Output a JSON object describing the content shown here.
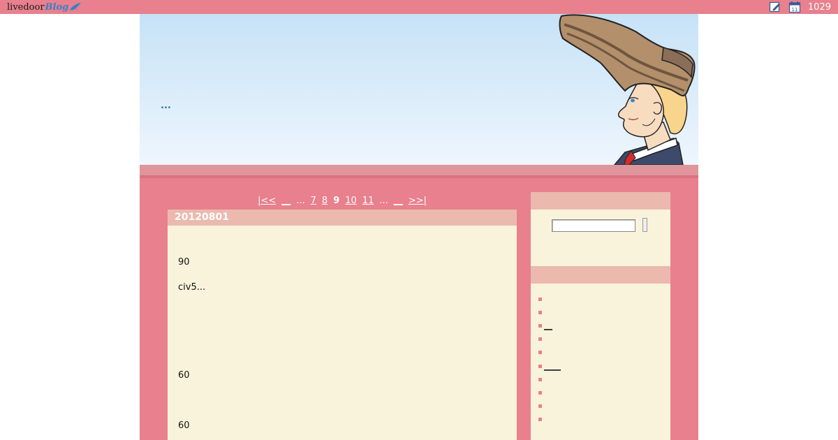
{
  "topbar": {
    "logo_main": "livedoor",
    "logo_blog": "Blog",
    "count": "1029",
    "icons": [
      "edit-icon",
      "calendar-icon"
    ],
    "calendar_day": "11"
  },
  "header": {
    "link_text": "..."
  },
  "pager": {
    "first": "|<<",
    "prev": "__",
    "ellipsis_left": "...",
    "pages": [
      "7",
      "8",
      "9",
      "10",
      "11"
    ],
    "current": "9",
    "ellipsis_right": "...",
    "next": "__",
    "last": ">>|"
  },
  "article": {
    "title": "20120801",
    "lines": [
      "90",
      "civ5...",
      "60",
      "60"
    ]
  },
  "sidebar": {
    "list_items": [
      "",
      "",
      "__",
      "",
      "",
      "____",
      "",
      "",
      "",
      ""
    ]
  },
  "colors": {
    "topbar": "#e8808d",
    "panel": "#faf3dc",
    "panel_header": "#ebb9ad",
    "band": "#e0949b"
  }
}
